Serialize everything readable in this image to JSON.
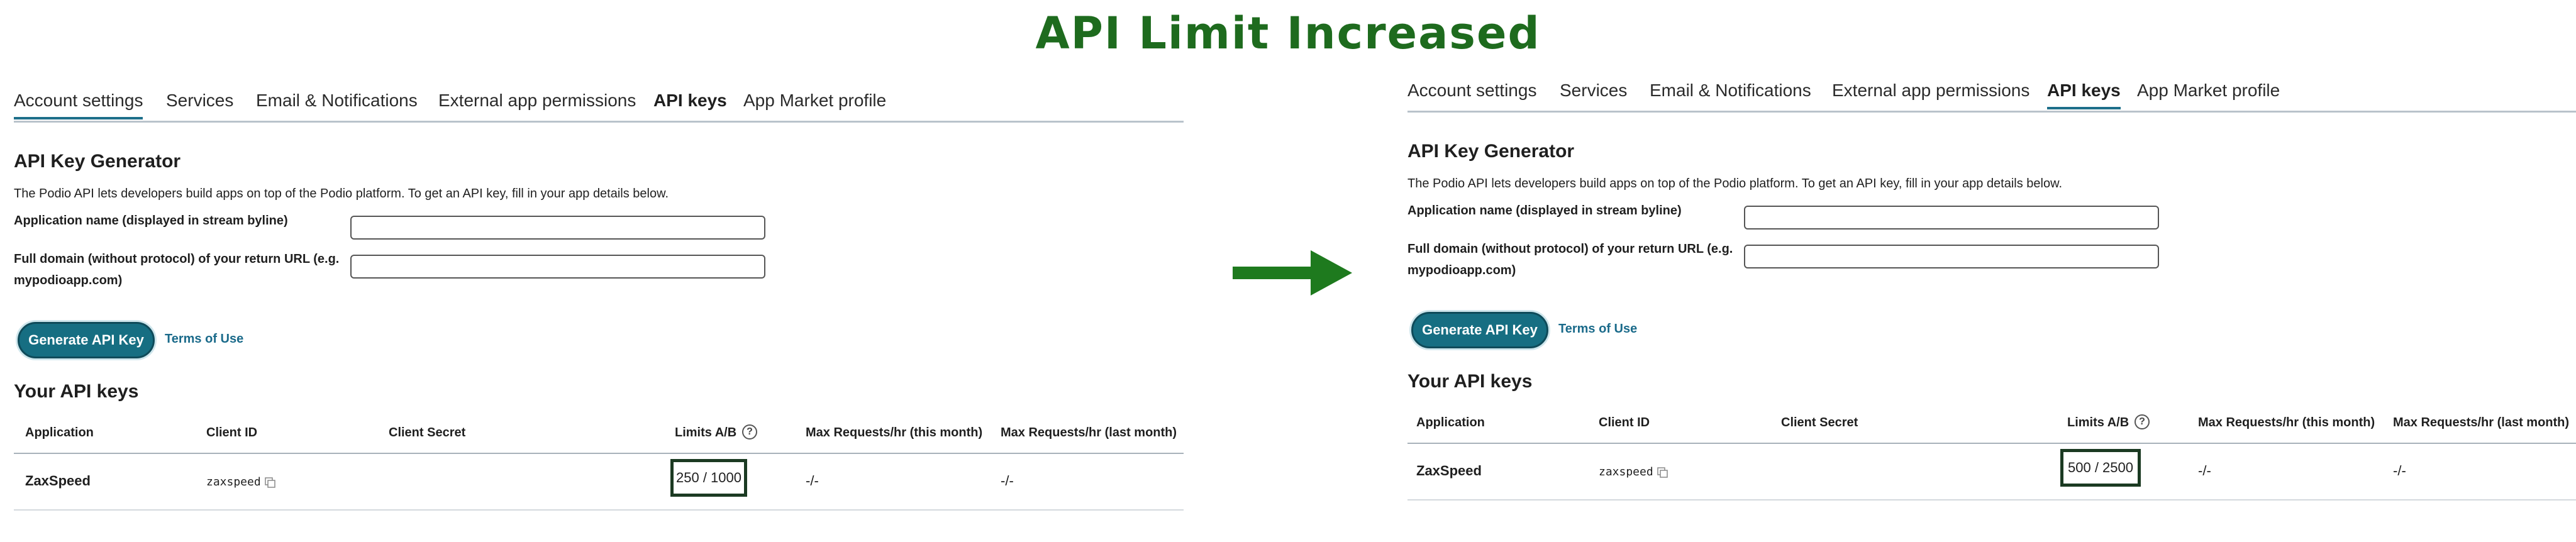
{
  "headline": "API Limit Increased",
  "colors": {
    "accent": "#166e82",
    "headline": "#1e6b1e",
    "arrow": "#1e7a1e",
    "highlight_border": "#1b3a22"
  },
  "tabs": [
    "Account settings",
    "Services",
    "Email & Notifications",
    "External app permissions",
    "API keys",
    "App Market profile"
  ],
  "active_tab": "API keys",
  "generator": {
    "title": "API Key Generator",
    "description": "The Podio API lets developers build apps on top of the Podio platform. To get an API key, fill in your app details below.",
    "app_name_label": "Application name (displayed in stream byline)",
    "domain_label": "Full domain (without protocol) of your return URL (e.g. mypodioapp.com)",
    "app_name_value": "",
    "domain_value": "",
    "generate_button": "Generate API Key",
    "terms_link": "Terms of Use"
  },
  "keys_title": "Your API keys",
  "columns": [
    "Application",
    "Client ID",
    "Client Secret",
    "Limits A/B",
    "Max Requests/hr (this month)",
    "Max Requests/hr (last month)"
  ],
  "help_icon": "question-circle-icon",
  "copy_icon": "copy-icon",
  "before": {
    "application": "ZaxSpeed",
    "client_id": "zaxspeed",
    "client_secret": "",
    "limits": "250 / 1000",
    "max_this_month": "-/-",
    "max_last_month": "-/-"
  },
  "after": {
    "application": "ZaxSpeed",
    "client_id": "zaxspeed",
    "client_secret": "",
    "limits": "500 / 2500",
    "max_this_month": "-/-",
    "max_last_month": "-/-"
  }
}
